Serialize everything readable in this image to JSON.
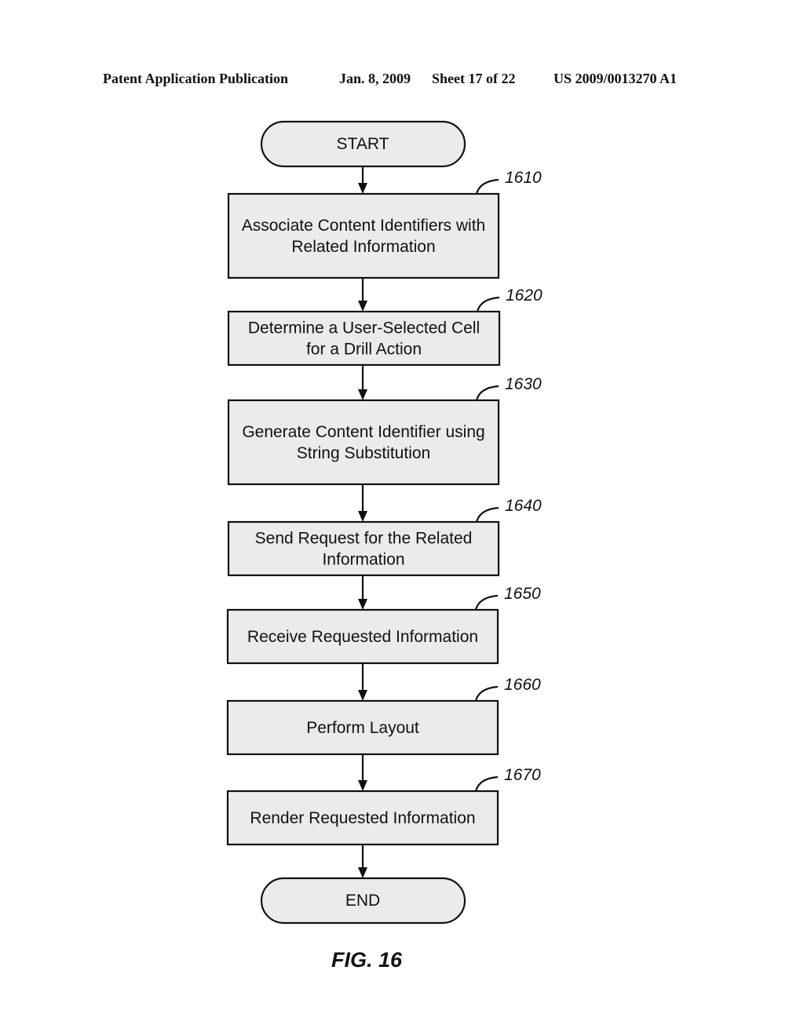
{
  "header": {
    "publication": "Patent Application Publication",
    "date": "Jan. 8, 2009",
    "sheet": "Sheet 17 of 22",
    "number": "US 2009/0013270 A1"
  },
  "flowchart": {
    "start": "START",
    "end": "END",
    "steps": [
      {
        "ref": "1610",
        "lines": [
          "Associate Content Identifiers with",
          "Related Information"
        ]
      },
      {
        "ref": "1620",
        "lines": [
          "Determine  a User-Selected Cell",
          "for a Drill Action"
        ]
      },
      {
        "ref": "1630",
        "lines": [
          "Generate Content Identifier using",
          "String Substitution"
        ]
      },
      {
        "ref": "1640",
        "lines": [
          "Send Request for the Related",
          "Information"
        ]
      },
      {
        "ref": "1650",
        "lines": [
          "Receive Requested Information"
        ]
      },
      {
        "ref": "1660",
        "lines": [
          "Perform Layout"
        ]
      },
      {
        "ref": "1670",
        "lines": [
          "Render Requested Information"
        ]
      }
    ]
  },
  "figure_label": "FIG. 16"
}
